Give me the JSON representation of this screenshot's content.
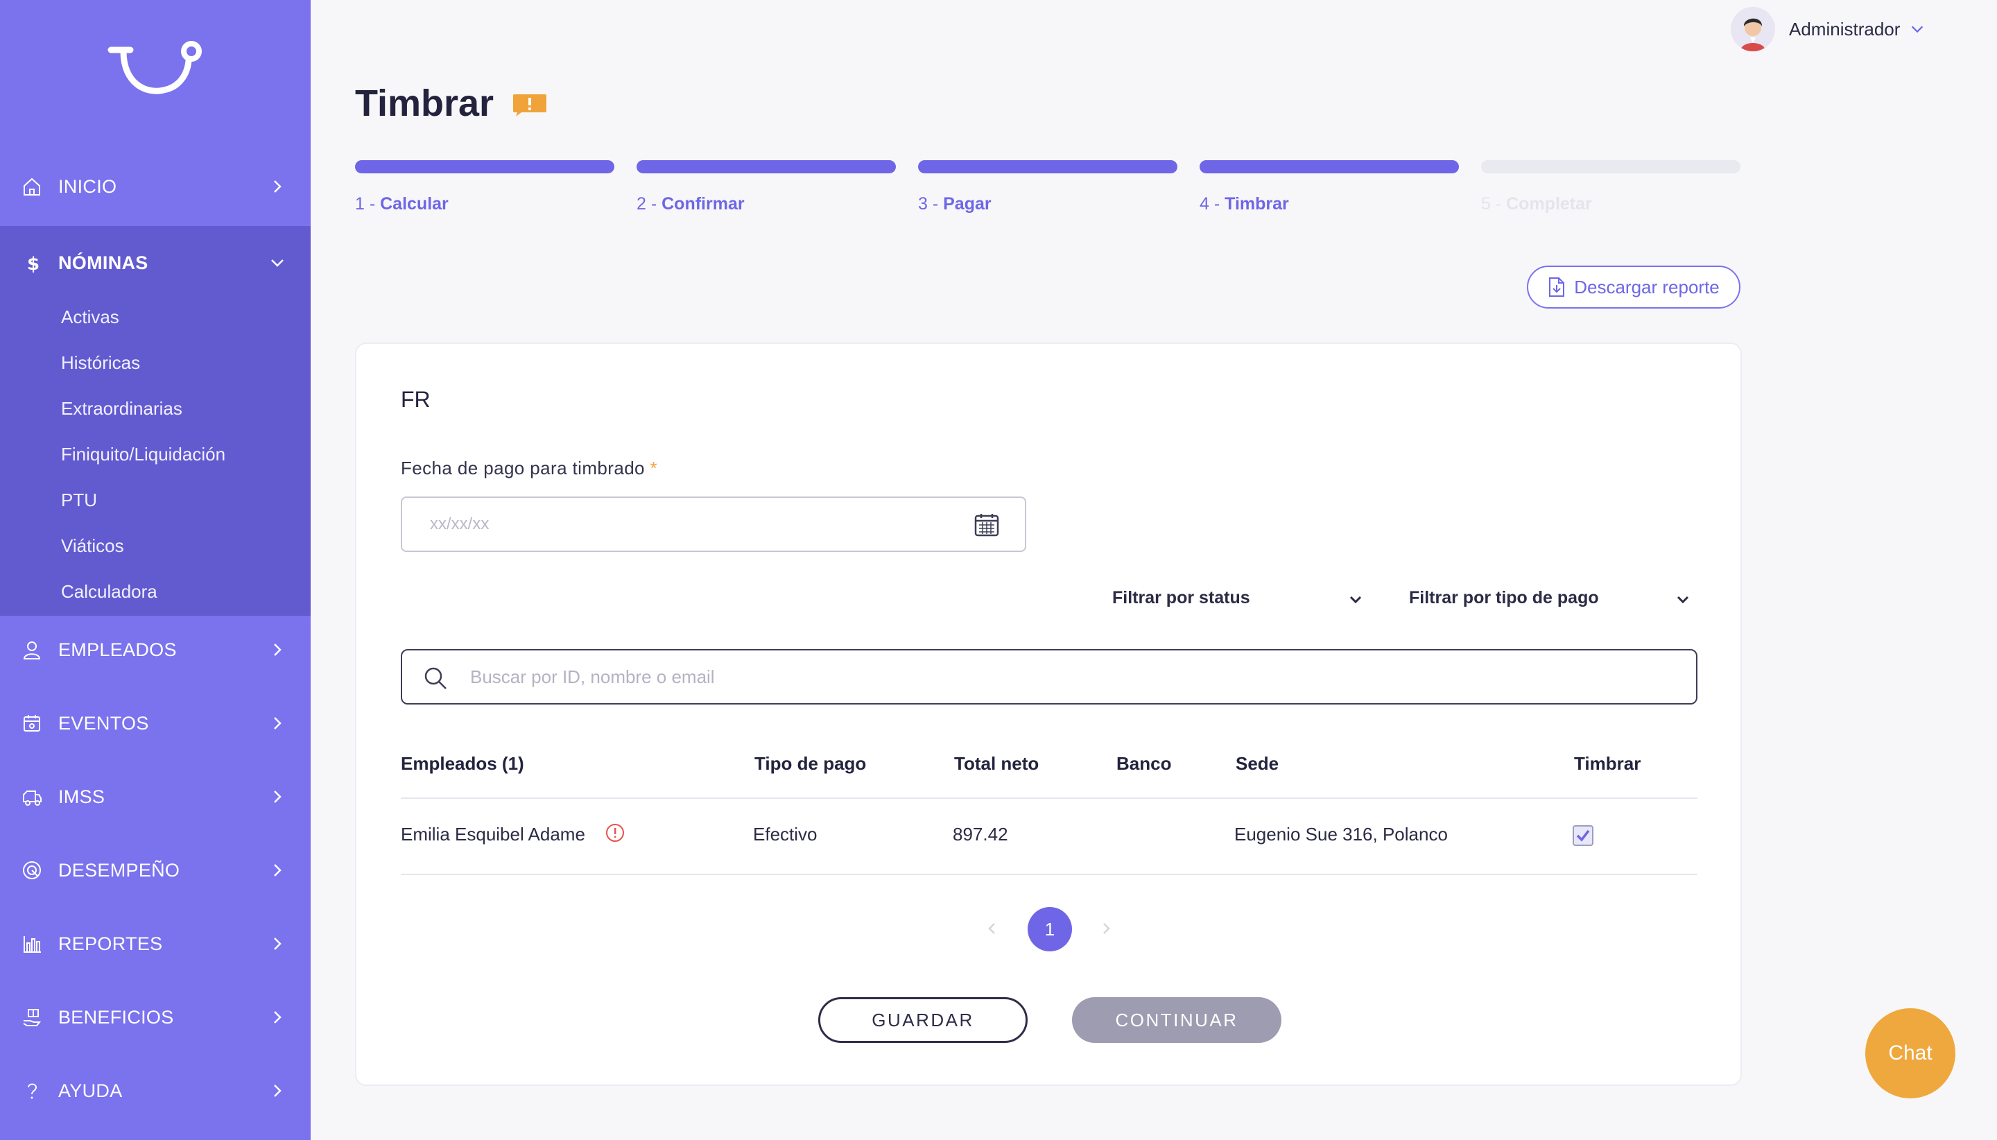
{
  "sidebar": {
    "items": [
      {
        "label": "INICIO",
        "icon": "home-icon"
      },
      {
        "label": "NÓMINAS",
        "icon": "dollar-icon"
      },
      {
        "label": "EMPLEADOS",
        "icon": "user-icon"
      },
      {
        "label": "EVENTOS",
        "icon": "calendar-icon"
      },
      {
        "label": "IMSS",
        "icon": "ambulance-icon"
      },
      {
        "label": "DESEMPEÑO",
        "icon": "target-icon"
      },
      {
        "label": "REPORTES",
        "icon": "bar-chart-icon"
      },
      {
        "label": "BENEFICIOS",
        "icon": "gift-hand-icon"
      },
      {
        "label": "AYUDA",
        "icon": "question-icon"
      }
    ],
    "submenu": [
      "Activas",
      "Históricas",
      "Extraordinarias",
      "Finiquito/Liquidación",
      "PTU",
      "Viáticos",
      "Calculadora"
    ]
  },
  "user": {
    "name": "Administrador"
  },
  "page": {
    "title": "Timbrar"
  },
  "stepper": {
    "steps": [
      {
        "num": "1 - ",
        "name": "Calcular"
      },
      {
        "num": "2 - ",
        "name": "Confirmar"
      },
      {
        "num": "3 - ",
        "name": "Pagar"
      },
      {
        "num": "4 - ",
        "name": "Timbrar"
      },
      {
        "num": "5 - ",
        "name": "Completar"
      }
    ],
    "completed": 4
  },
  "download_label": "Descargar reporte",
  "card": {
    "title": "FR",
    "date_label": "Fecha de pago para timbrado",
    "date_required": "*",
    "date_placeholder": "xx/xx/xx",
    "filter_status": "Filtrar por status",
    "filter_tipo": "Filtrar por tipo de pago",
    "search_placeholder": "Buscar por ID, nombre o email"
  },
  "table": {
    "headers": [
      "Empleados (1)",
      "Tipo de pago",
      "Total neto",
      "Banco",
      "Sede",
      "Timbrar"
    ],
    "rows": [
      {
        "empleado": "Emilia Esquibel Adame",
        "tipo": "Efectivo",
        "total": "897.42",
        "banco": "",
        "sede": "Eugenio Sue 316, Polanco",
        "timbrar": true
      }
    ]
  },
  "pagination": {
    "current": "1"
  },
  "buttons": {
    "save": "GUARDAR",
    "continue": "CONTINUAR"
  },
  "chat": {
    "label": "Chat"
  },
  "colors": {
    "accent": "#7b72ee",
    "sidebar_open": "#625bd0",
    "chat": "#efa83e",
    "badge": "#f0a33a",
    "warning": "#e5534b"
  }
}
